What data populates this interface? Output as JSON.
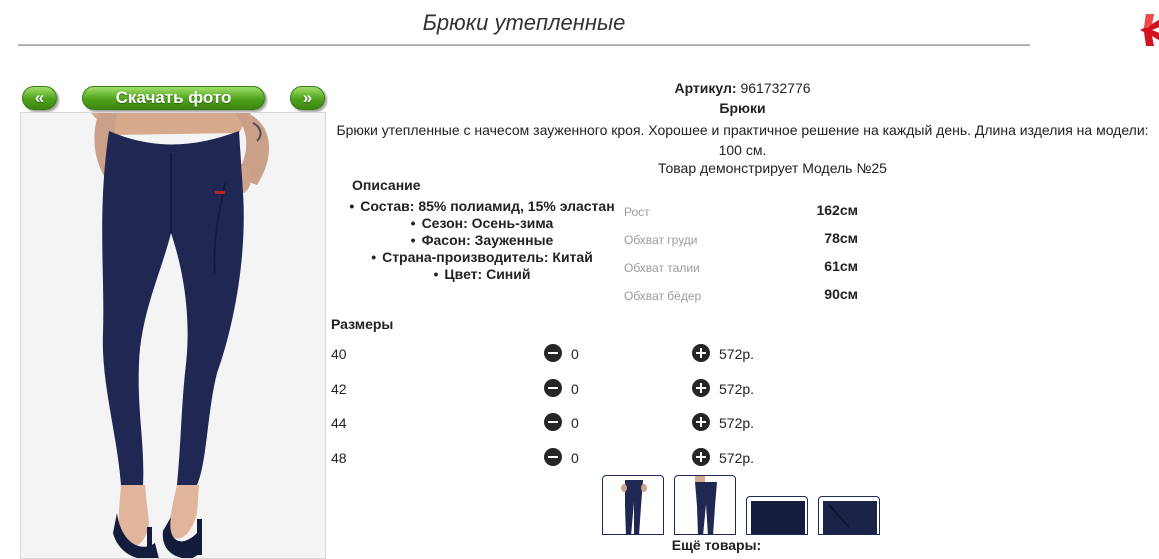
{
  "page": {
    "title": "Брюки утепленные"
  },
  "nav": {
    "prev_label": "«",
    "download_label": "Скачать фото",
    "next_label": "»"
  },
  "product": {
    "sku_label": "Артикул:",
    "sku_value": "961732776",
    "category": "Брюки",
    "description": "Брюки утепленные с начесом зауженного кроя. Хорошее и практичное решение на каждый день. Длина изделия на модели: 100 см.",
    "model_note": "Товар демонстрирует Модель №25"
  },
  "specs": {
    "heading": "Описание",
    "items": [
      "Состав: 85% полиамид, 15% эластан",
      "Сезон: Осень-зима",
      "Фасон: Зауженные",
      "Страна-производитель: Китай",
      "Цвет: Синий"
    ]
  },
  "measurements": [
    {
      "label": "Рост",
      "value": "162см"
    },
    {
      "label": "Обхват груди",
      "value": "78см"
    },
    {
      "label": "Обхват талии",
      "value": "61см"
    },
    {
      "label": "Обхват бёдер",
      "value": "90см"
    }
  ],
  "sizes": {
    "heading": "Размеры",
    "rows": [
      {
        "size": "40",
        "qty": "0",
        "price": "572р."
      },
      {
        "size": "42",
        "qty": "0",
        "price": "572р."
      },
      {
        "size": "44",
        "qty": "0",
        "price": "572р."
      },
      {
        "size": "48",
        "qty": "0",
        "price": "572р."
      }
    ]
  },
  "more": {
    "label": "Ещё товары:"
  },
  "colors": {
    "button_green": "#4fa21b",
    "product_navy": "#1f2752",
    "close_red": "#d0131f"
  },
  "icons": [
    "close-icon",
    "minus-circle-icon",
    "plus-circle-icon"
  ]
}
